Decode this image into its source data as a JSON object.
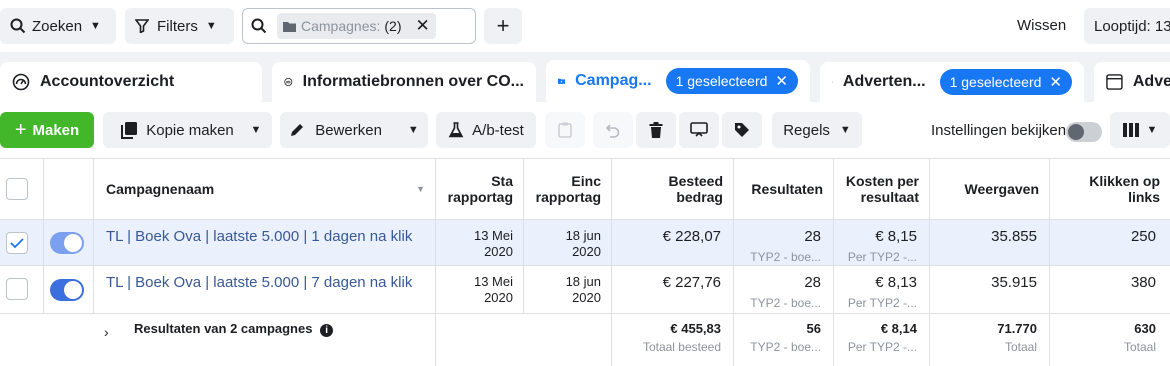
{
  "topbar": {
    "search_label": "Zoeken",
    "filters_label": "Filters",
    "chip_label": "Campagnes:",
    "chip_count": "(2)",
    "clear_label": "Wissen",
    "runtime_label": "Looptijd: 13"
  },
  "tabs": {
    "account": "Accountoverzicht",
    "sources": "Informatiebronnen over CO...",
    "campaigns": "Campag...",
    "campaigns_selected": "1 geselecteerd",
    "ads": "Adverten...",
    "ads_selected": "1 geselecteerd",
    "adv": "Adve"
  },
  "toolbar": {
    "create": "Maken",
    "copy": "Kopie maken",
    "edit": "Bewerken",
    "abtest": "A/b-test",
    "rules": "Regels",
    "settings": "Instellingen bekijken"
  },
  "table": {
    "headers": {
      "name": "Campagnenaam",
      "start": "Sta rapportag",
      "end": "Einc rapportag",
      "spent": "Besteed bedrag",
      "results": "Resultaten",
      "cost": "Kosten per resultaat",
      "impressions": "Weergaven",
      "clicks": "Klikken op links"
    },
    "rows": [
      {
        "name": "TL | Boek Ova | laatste 5.000 | 1 dagen na klik",
        "start_date": "13 Mei",
        "start_year": "2020",
        "end_date": "18 jun",
        "end_year": "2020",
        "spent": "€ 228,07",
        "results": "28",
        "results_sub": "TYP2 - boe...",
        "cost": "€ 8,15",
        "cost_sub": "Per TYP2 -...",
        "impressions": "35.855",
        "clicks": "250"
      },
      {
        "name": "TL | Boek Ova | laatste 5.000 | 7 dagen na klik",
        "start_date": "13 Mei",
        "start_year": "2020",
        "end_date": "18 jun",
        "end_year": "2020",
        "spent": "€ 227,76",
        "results": "28",
        "results_sub": "TYP2 - boe...",
        "cost": "€ 8,13",
        "cost_sub": "Per TYP2 -...",
        "impressions": "35.915",
        "clicks": "380"
      }
    ],
    "totals": {
      "label": "Resultaten van 2 campagnes",
      "spent": "€ 455,83",
      "spent_sub": "Totaal besteed",
      "results": "56",
      "results_sub": "TYP2 - boe...",
      "cost": "€ 8,14",
      "cost_sub": "Per TYP2 -...",
      "impressions": "71.770",
      "impressions_sub": "Totaal",
      "clicks": "630",
      "clicks_sub": "Totaal"
    }
  },
  "colors": {
    "accent": "#1877f2",
    "create_button": "#42b72a",
    "link": "#385898",
    "selected_row": "#ebf1fc"
  },
  "icons": [
    "search-icon",
    "funnel-icon",
    "folder-icon",
    "close-icon",
    "plus-icon",
    "dashboard-icon",
    "info-source-icon",
    "campaign-folder-icon",
    "ad-grid-icon",
    "copy-icon",
    "pencil-icon",
    "flask-icon",
    "clipboard-icon",
    "undo-icon",
    "trash-icon",
    "preview-icon",
    "tag-icon",
    "columns-icon",
    "chevron-down-icon",
    "chevron-right-icon",
    "info-icon"
  ]
}
